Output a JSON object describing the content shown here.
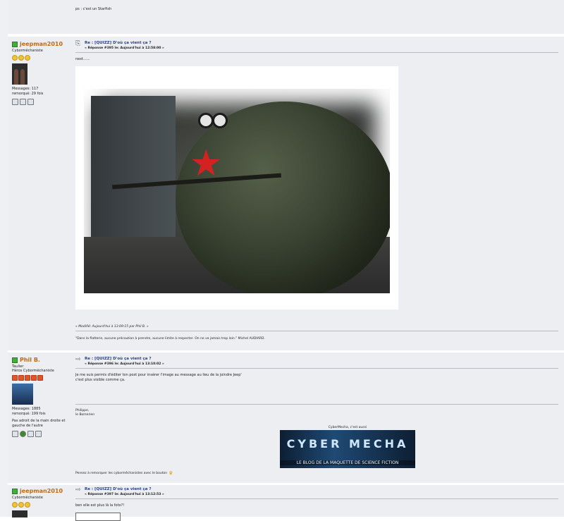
{
  "post1": {
    "text": "ps : c'est un Starfish"
  },
  "post2": {
    "username": "jeepman2010",
    "rank": "Cybormêchaniste",
    "messages": "Messages: 117",
    "remorque": "remorqué: 29 fois",
    "subject": "Re : [QUIZZ] D'où ça vient ça ?",
    "reply": "« Réponse #395 le: Aujourd'hui à 12:58:00 »",
    "body": "next......",
    "modified": "« Modifié: Aujourd'hui à 13:09:15 par Phil B. »",
    "quote": "\"Dans la flatterie, aucune précaution à prendre, aucune limite à respecter. On ne va jamais trop loin.\" Michel AUDIARD."
  },
  "post3": {
    "username": "Phil B.",
    "rank1": "Taulier",
    "rank2": "Héros Cybormêchaniste",
    "messages": "Messages: 1885",
    "remorque": "remorqué: 199 fois",
    "desc": "Pas adroit de la main droite et gauche de l'autre",
    "subject": "Re : [QUIZZ] D'où ça vient ça ?",
    "reply": "« Réponse #396 le: Aujourd'hui à 13:10:02 »",
    "body_line1": "Je me suis permis d'éditer ton post pour insérer l'image au message au lieu de la joindre Jeep'",
    "body_line2": "c'est plus visible comme ça.",
    "sig1": "Philippe,",
    "sig2": "le Bomerien",
    "banner_caption": "CyberMecha, c'est aussi",
    "banner_title": "CYBER MECHA",
    "banner_sub": "LE BLOG DE LA MAQUETTE DE SCIENCE FICTION",
    "thank": "Pensez à remorquer les cybormêchanistes avec le bouton"
  },
  "post4": {
    "username": "jeepman2010",
    "rank": "Cybormêchaniste",
    "subject": "Re : [QUIZZ] D'où ça vient ça ?",
    "reply": "« Réponse #397 le: Aujourd'hui à 13:12:53 »",
    "body": "ben elle est plus là la foto?!"
  }
}
